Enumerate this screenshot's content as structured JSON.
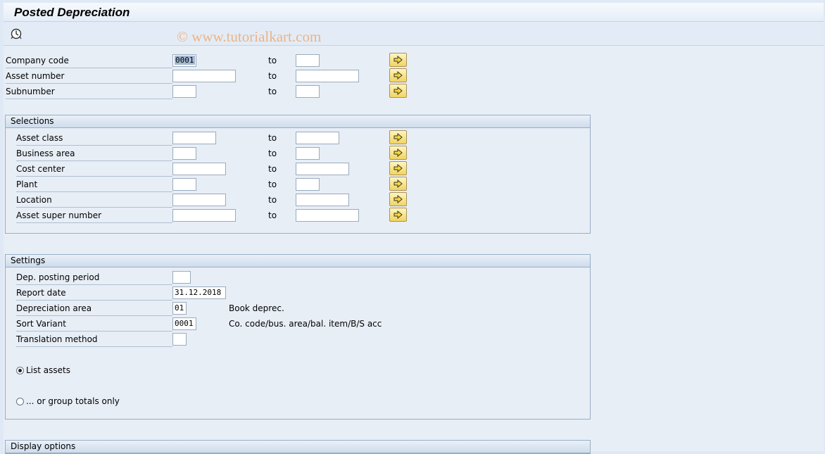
{
  "title": "Posted Depreciation",
  "watermark": "© www.tutorialkart.com",
  "toolbar": {
    "execute_icon": "clock-execute-icon"
  },
  "top_fields": [
    {
      "label": "Company code",
      "from": "0001",
      "to": "",
      "to_label": "to"
    },
    {
      "label": "Asset number",
      "from": "",
      "to": "",
      "to_label": "to"
    },
    {
      "label": "Subnumber",
      "from": "",
      "to": "",
      "to_label": "to"
    }
  ],
  "selections": {
    "title": "Selections",
    "fields": [
      {
        "label": "Asset class",
        "from": "",
        "to": "",
        "to_label": "to"
      },
      {
        "label": "Business area",
        "from": "",
        "to": "",
        "to_label": "to"
      },
      {
        "label": "Cost center",
        "from": "",
        "to": "",
        "to_label": "to"
      },
      {
        "label": "Plant",
        "from": "",
        "to": "",
        "to_label": "to"
      },
      {
        "label": "Location",
        "from": "",
        "to": "",
        "to_label": "to"
      },
      {
        "label": "Asset super number",
        "from": "",
        "to": "",
        "to_label": "to"
      }
    ]
  },
  "settings": {
    "title": "Settings",
    "fields": [
      {
        "label": "Dep. posting period",
        "value": "",
        "desc": ""
      },
      {
        "label": "Report date",
        "value": "31.12.2018",
        "desc": ""
      },
      {
        "label": "Depreciation area",
        "value": "01",
        "desc": "Book deprec."
      },
      {
        "label": "Sort Variant",
        "value": "0001",
        "desc": "Co. code/bus. area/bal. item/B/S acc"
      },
      {
        "label": "Translation method",
        "value": "",
        "desc": ""
      }
    ],
    "radio_list_assets": "List assets",
    "radio_group_totals": "... or group totals only",
    "selected_radio": "List assets"
  },
  "display_options": {
    "title": "Display options"
  },
  "colors": {
    "background": "#dfe9f5",
    "group_header": "#cfdcec",
    "multi_button": "#f2d461"
  }
}
